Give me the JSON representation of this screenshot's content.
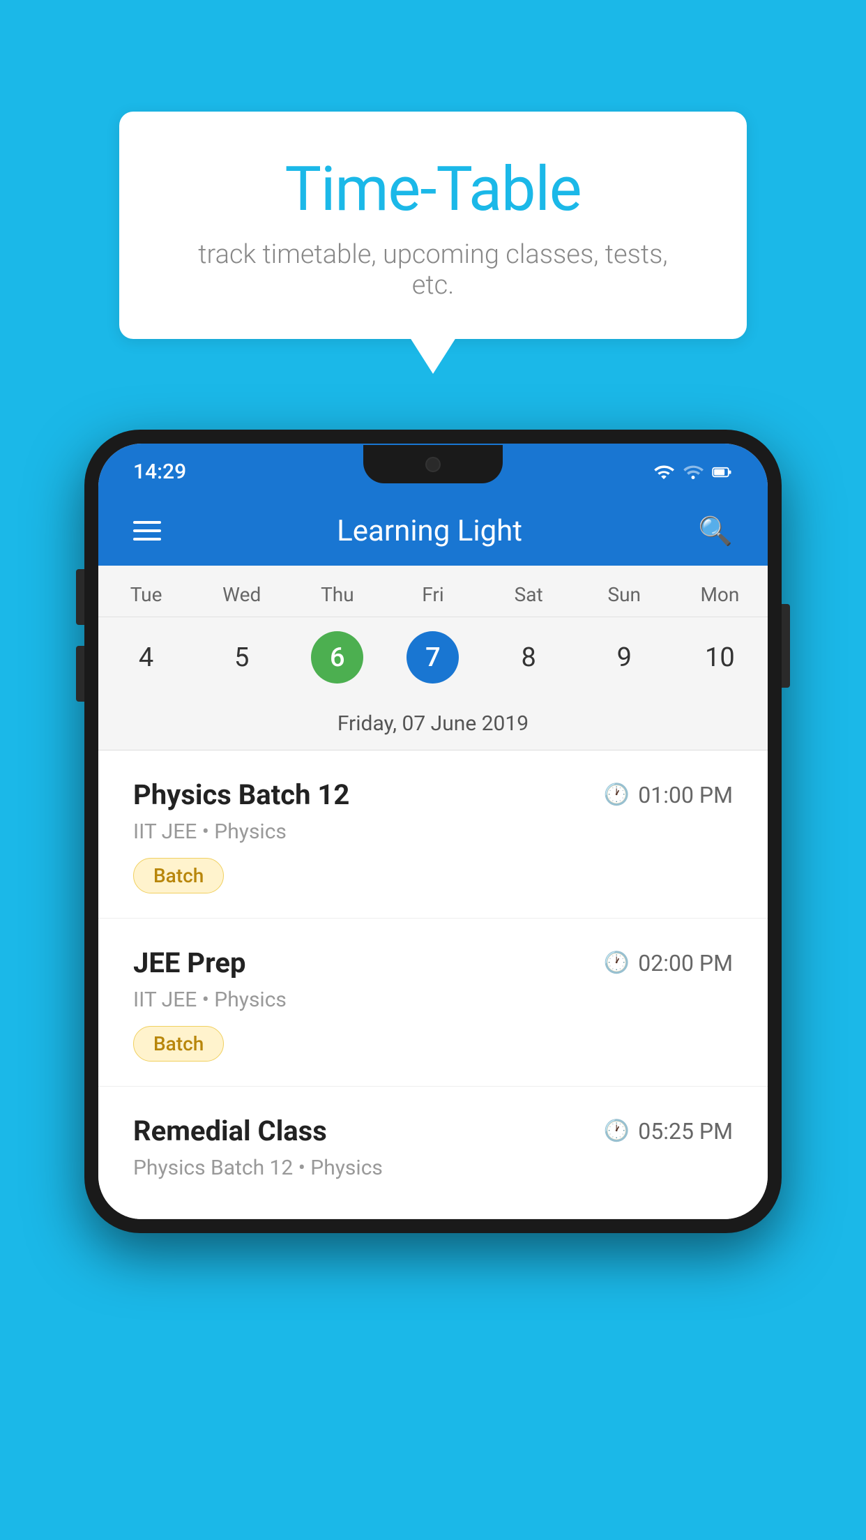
{
  "background_color": "#1BB8E8",
  "speech_bubble": {
    "title": "Time-Table",
    "subtitle": "track timetable, upcoming classes, tests, etc."
  },
  "phone": {
    "status_bar": {
      "time": "14:29"
    },
    "app_bar": {
      "title": "Learning Light"
    },
    "calendar": {
      "days": [
        "Tue",
        "Wed",
        "Thu",
        "Fri",
        "Sat",
        "Sun",
        "Mon"
      ],
      "dates": [
        "4",
        "5",
        "6",
        "7",
        "8",
        "9",
        "10"
      ],
      "today_index": 2,
      "selected_index": 3,
      "selected_label": "Friday, 07 June 2019"
    },
    "schedule": [
      {
        "title": "Physics Batch 12",
        "time": "01:00 PM",
        "subtitle": "IIT JEE • Physics",
        "badge": "Batch"
      },
      {
        "title": "JEE Prep",
        "time": "02:00 PM",
        "subtitle": "IIT JEE • Physics",
        "badge": "Batch"
      },
      {
        "title": "Remedial Class",
        "time": "05:25 PM",
        "subtitle": "Physics Batch 12 • Physics",
        "badge": null
      }
    ]
  }
}
